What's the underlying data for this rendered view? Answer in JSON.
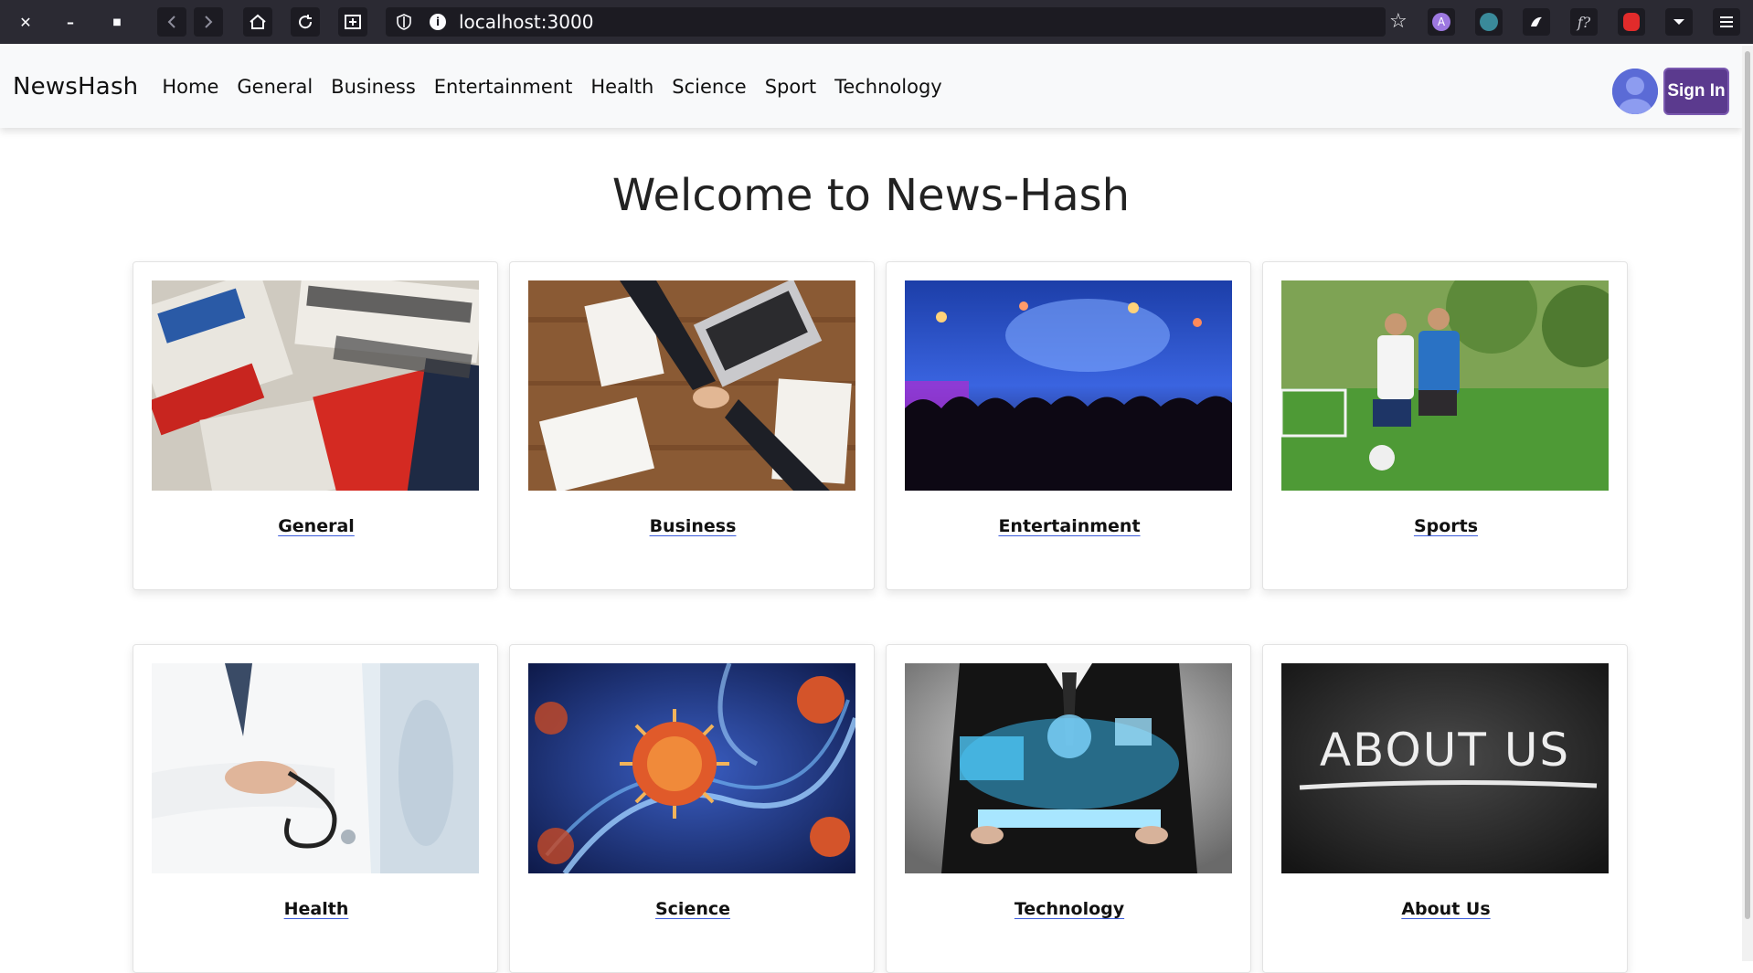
{
  "browser": {
    "url": "localhost:3000",
    "icons": [
      "close-icon",
      "minimize-icon",
      "maximize-icon",
      "back-icon",
      "forward-icon",
      "home-icon",
      "reload-icon",
      "screenshot-icon",
      "shield-icon",
      "info-icon",
      "bookmark-star-icon",
      "extension-a-icon",
      "extension-globe-icon",
      "extension-bird-icon",
      "extension-formula-icon",
      "extension-red-icon",
      "dropdown-icon",
      "menu-icon"
    ],
    "ext_a_label": "A",
    "ext_f_label": "f?"
  },
  "navbar": {
    "brand": "NewsHash",
    "links": [
      "Home",
      "General",
      "Business",
      "Entertainment",
      "Health",
      "Science",
      "Sport",
      "Technology"
    ],
    "signin_label": "Sign In"
  },
  "main": {
    "heading": "Welcome to News-Hash",
    "cards": [
      {
        "title": "General",
        "image": "newspapers"
      },
      {
        "title": "Business",
        "image": "handshake-desk"
      },
      {
        "title": "Entertainment",
        "image": "concert-crowd"
      },
      {
        "title": "Sports",
        "image": "soccer-players"
      },
      {
        "title": "Health",
        "image": "doctor-stethoscope"
      },
      {
        "title": "Science",
        "image": "virus-dna"
      },
      {
        "title": "Technology",
        "image": "businessman-tablet"
      },
      {
        "title": "About Us",
        "image": "chalkboard-about-us"
      }
    ],
    "chalkboard_text": "ABOUT US"
  },
  "colors": {
    "chrome_bg": "#2b2a33",
    "navbar_bg": "#f8f9fa",
    "signin_bg": "#5b3a8e",
    "link_underline": "#3b5bdb"
  }
}
